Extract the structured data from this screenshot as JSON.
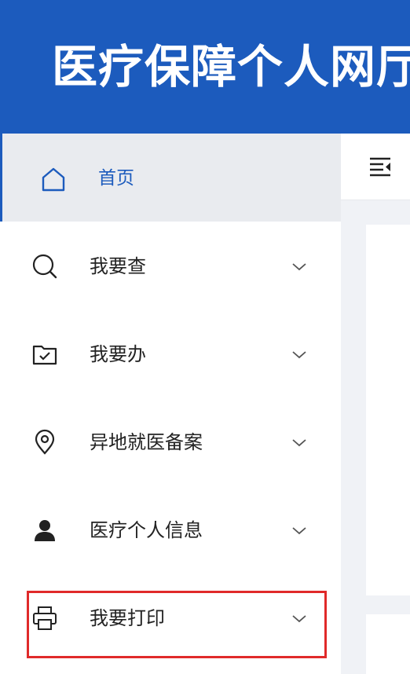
{
  "header": {
    "title": "医疗保障个人网厅"
  },
  "sidebar": {
    "home": {
      "label": "首页",
      "icon": "home-icon",
      "active": true
    },
    "items": [
      {
        "label": "我要查",
        "icon": "search-icon"
      },
      {
        "label": "我要办",
        "icon": "folder-check-icon"
      },
      {
        "label": "异地就医备案",
        "icon": "location-pin-icon"
      },
      {
        "label": "医疗个人信息",
        "icon": "user-icon"
      },
      {
        "label": "我要打印",
        "icon": "printer-icon",
        "highlighted": true
      }
    ]
  },
  "toolbar": {
    "collapse_icon": "menu-collapse-icon"
  },
  "colors": {
    "brand": "#1c5bbd",
    "active_bg": "#e9ebef",
    "highlight": "#e02a2a"
  }
}
